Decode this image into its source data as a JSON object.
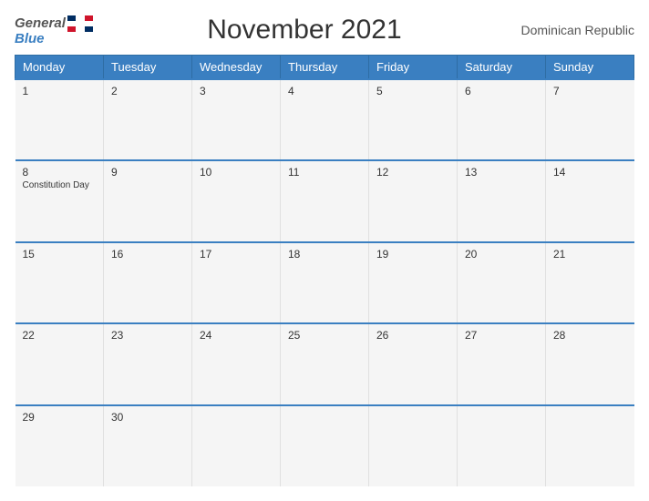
{
  "header": {
    "logo_general": "General",
    "logo_blue": "Blue",
    "title": "November 2021",
    "country": "Dominican Republic"
  },
  "weekdays": [
    "Monday",
    "Tuesday",
    "Wednesday",
    "Thursday",
    "Friday",
    "Saturday",
    "Sunday"
  ],
  "weeks": [
    [
      {
        "day": "1",
        "holiday": ""
      },
      {
        "day": "2",
        "holiday": ""
      },
      {
        "day": "3",
        "holiday": ""
      },
      {
        "day": "4",
        "holiday": ""
      },
      {
        "day": "5",
        "holiday": ""
      },
      {
        "day": "6",
        "holiday": ""
      },
      {
        "day": "7",
        "holiday": ""
      }
    ],
    [
      {
        "day": "8",
        "holiday": "Constitution Day"
      },
      {
        "day": "9",
        "holiday": ""
      },
      {
        "day": "10",
        "holiday": ""
      },
      {
        "day": "11",
        "holiday": ""
      },
      {
        "day": "12",
        "holiday": ""
      },
      {
        "day": "13",
        "holiday": ""
      },
      {
        "day": "14",
        "holiday": ""
      }
    ],
    [
      {
        "day": "15",
        "holiday": ""
      },
      {
        "day": "16",
        "holiday": ""
      },
      {
        "day": "17",
        "holiday": ""
      },
      {
        "day": "18",
        "holiday": ""
      },
      {
        "day": "19",
        "holiday": ""
      },
      {
        "day": "20",
        "holiday": ""
      },
      {
        "day": "21",
        "holiday": ""
      }
    ],
    [
      {
        "day": "22",
        "holiday": ""
      },
      {
        "day": "23",
        "holiday": ""
      },
      {
        "day": "24",
        "holiday": ""
      },
      {
        "day": "25",
        "holiday": ""
      },
      {
        "day": "26",
        "holiday": ""
      },
      {
        "day": "27",
        "holiday": ""
      },
      {
        "day": "28",
        "holiday": ""
      }
    ],
    [
      {
        "day": "29",
        "holiday": ""
      },
      {
        "day": "30",
        "holiday": ""
      },
      {
        "day": "",
        "holiday": ""
      },
      {
        "day": "",
        "holiday": ""
      },
      {
        "day": "",
        "holiday": ""
      },
      {
        "day": "",
        "holiday": ""
      },
      {
        "day": "",
        "holiday": ""
      }
    ]
  ]
}
